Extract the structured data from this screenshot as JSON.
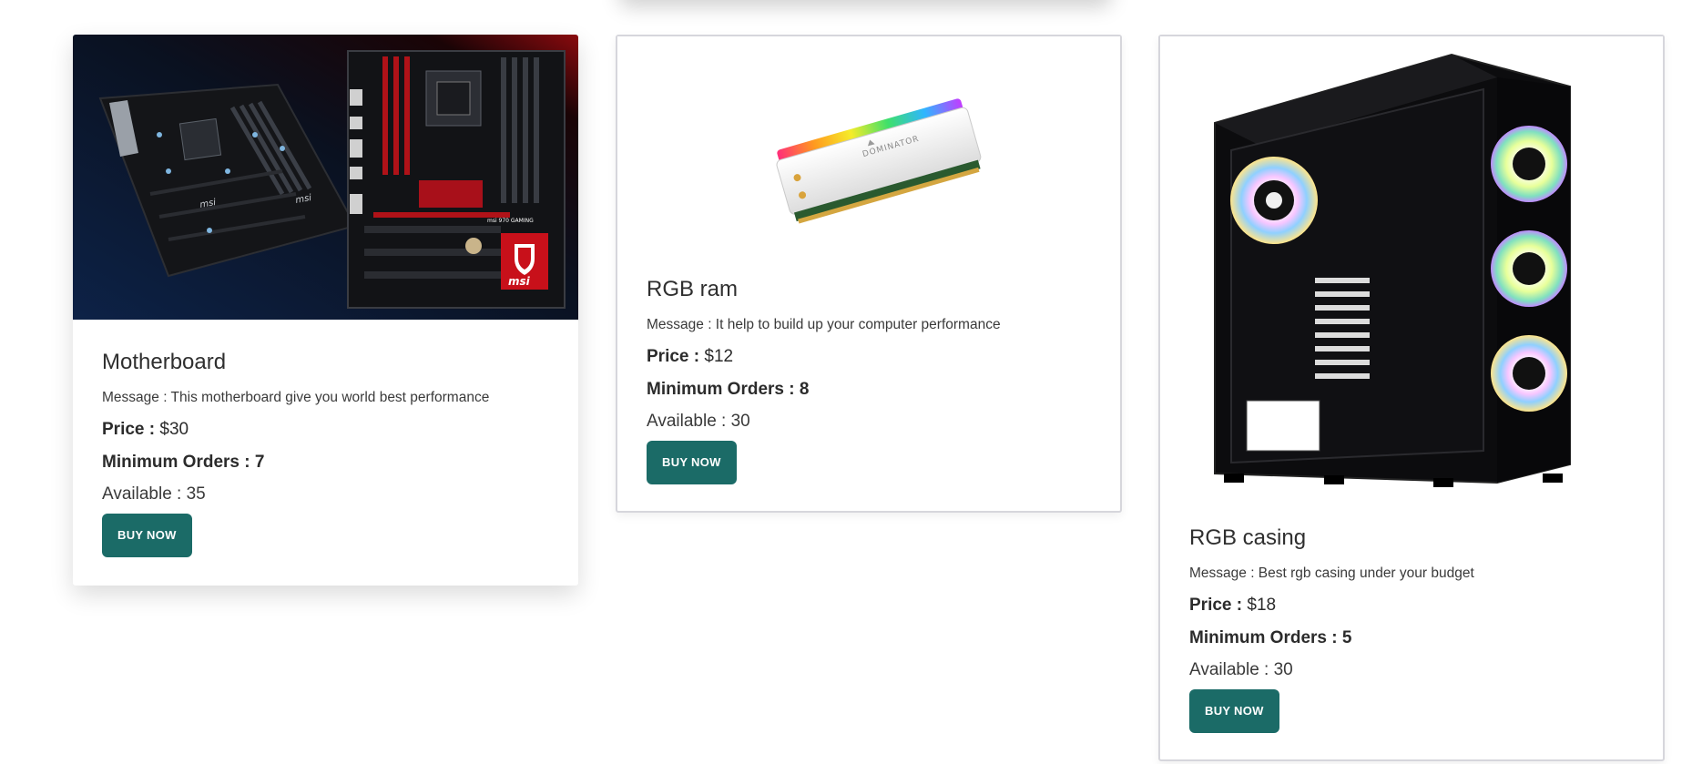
{
  "products": [
    {
      "title": "Motherboard",
      "message": "Message : This motherboard give you world best performance",
      "price_label": "Price :",
      "price_value": "$30",
      "min_orders": "Minimum Orders : 7",
      "available": "Available : 35",
      "button": "BUY NOW",
      "image": "motherboard-image"
    },
    {
      "title": "RGB ram",
      "message": "Message : It help to build up your computer performance",
      "price_label": "Price :",
      "price_value": "$12",
      "min_orders": "Minimum Orders : 8",
      "available": "Available : 30",
      "button": "BUY NOW",
      "image": "ram-image"
    },
    {
      "title": "RGB casing",
      "message": "Message : Best rgb casing under your budget",
      "price_label": "Price :",
      "price_value": "$18",
      "min_orders": "Minimum Orders : 5",
      "available": "Available : 30",
      "button": "BUY NOW",
      "image": "pc-case-image"
    }
  ],
  "colors": {
    "button_bg": "#1b6b67",
    "button_text": "#ffffff",
    "card_border": "#d6d6dc"
  }
}
